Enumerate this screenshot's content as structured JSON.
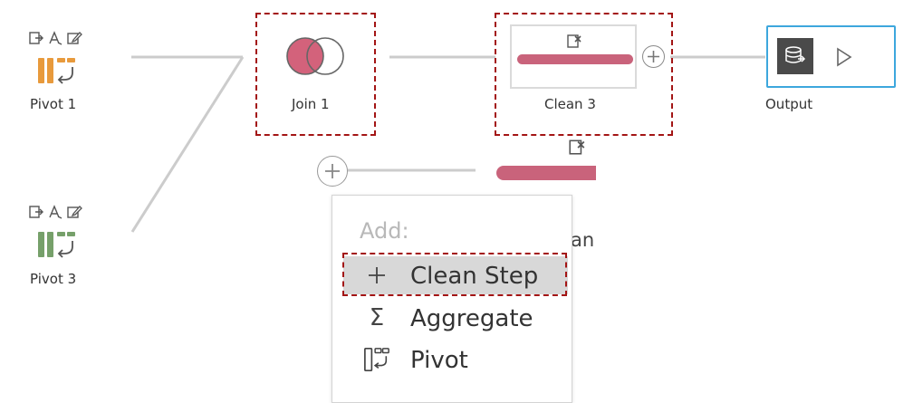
{
  "nodes": {
    "pivot1": {
      "label": "Pivot 1",
      "color": "#e89a3c"
    },
    "pivot3": {
      "label": "Pivot 3",
      "color": "#76a06a"
    },
    "join1": {
      "label": "Join 1",
      "fill": "#d3627b"
    },
    "clean3": {
      "label": "Clean 3",
      "bar_color": "#c9637b"
    },
    "output": {
      "label": "Output",
      "border_color": "#3da7dd"
    }
  },
  "partial_label": "an",
  "menu": {
    "header": "Add:",
    "items": [
      {
        "icon": "plus-icon",
        "glyph": "+",
        "label": "Clean Step",
        "selected": true
      },
      {
        "icon": "sigma-icon",
        "glyph": "Σ",
        "label": "Aggregate",
        "selected": false
      },
      {
        "icon": "pivot-icon",
        "glyph": "",
        "label": "Pivot",
        "selected": false
      }
    ]
  },
  "highlight_color": "#a31515"
}
